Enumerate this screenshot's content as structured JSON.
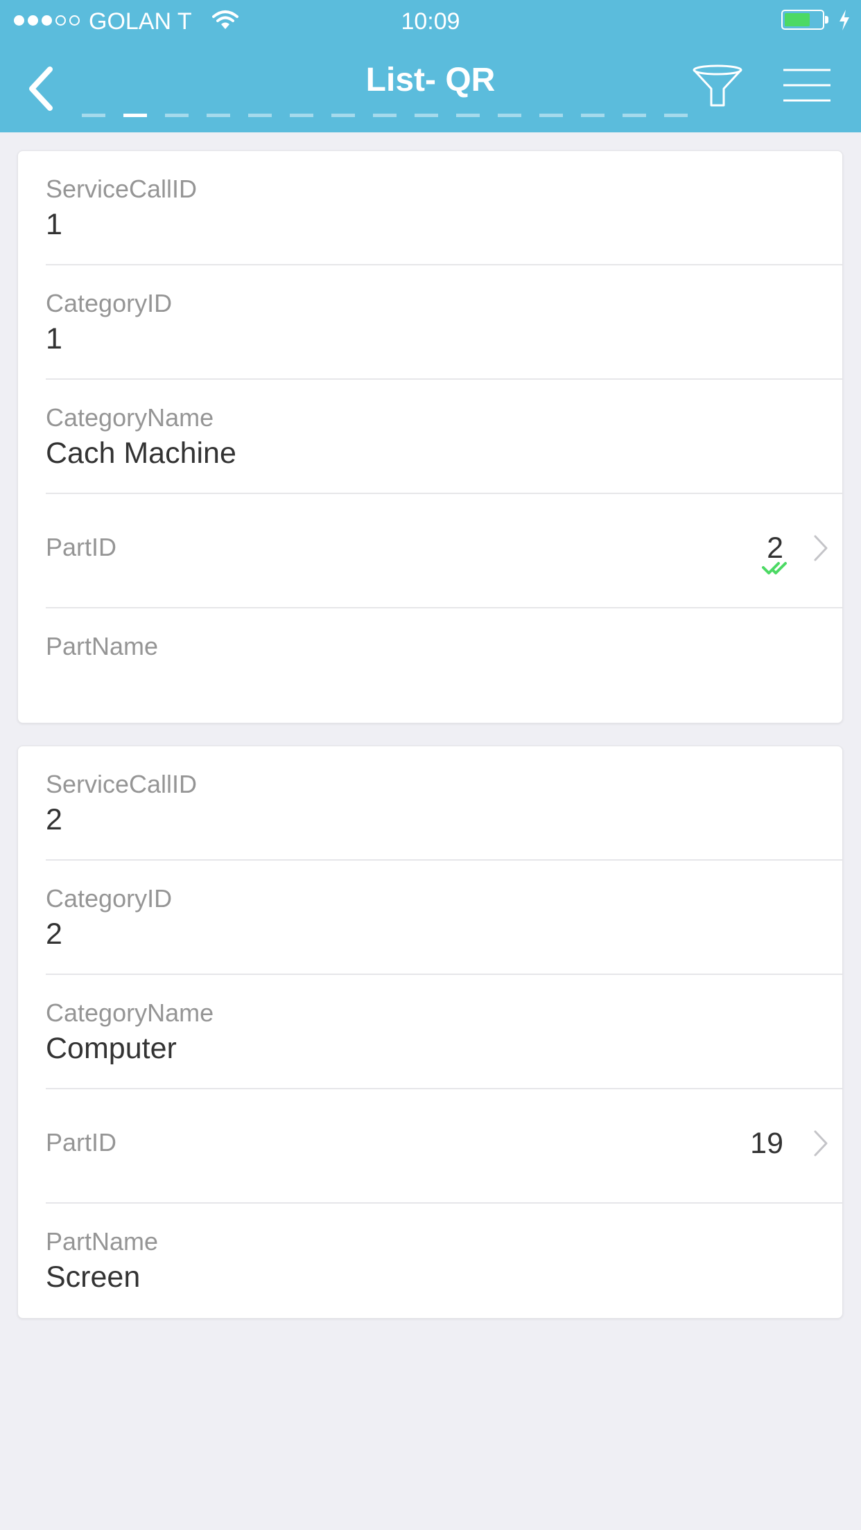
{
  "status_bar": {
    "carrier": "GOLAN T",
    "time": "10:09",
    "signal_strength": 3,
    "signal_max": 5,
    "battery_level": 0.7,
    "battery_color": "#4cd964",
    "icons": [
      "wifi-icon",
      "battery-icon",
      "charging-icon"
    ]
  },
  "header": {
    "title": "List- QR",
    "background": "#5bbcdc",
    "back_icon": "chevron-left-icon",
    "filter_icon": "funnel-icon",
    "menu_icon": "hamburger-menu-icon",
    "page_count": 15,
    "active_page": 2
  },
  "records": [
    {
      "service_call_label": "ServiceCallID",
      "service_call_value": "1",
      "category_id_label": "CategoryID",
      "category_id_value": "1",
      "category_name_label": "CategoryName",
      "category_name_value": "Cach Machine",
      "part_id_label": "PartID",
      "part_id_value": "2",
      "part_id_checked": true,
      "part_name_label": "PartName",
      "part_name_value": ""
    },
    {
      "service_call_label": "ServiceCallID",
      "service_call_value": "2",
      "category_id_label": "CategoryID",
      "category_id_value": "2",
      "category_name_label": "CategoryName",
      "category_name_value": "Computer",
      "part_id_label": "PartID",
      "part_id_value": "19",
      "part_id_checked": false,
      "part_name_label": "PartName",
      "part_name_value": "Screen"
    }
  ],
  "colors": {
    "accent": "#5bbcdc",
    "label": "#959595",
    "value": "#333333",
    "check": "#4cd964",
    "page_background": "#efeff4"
  }
}
